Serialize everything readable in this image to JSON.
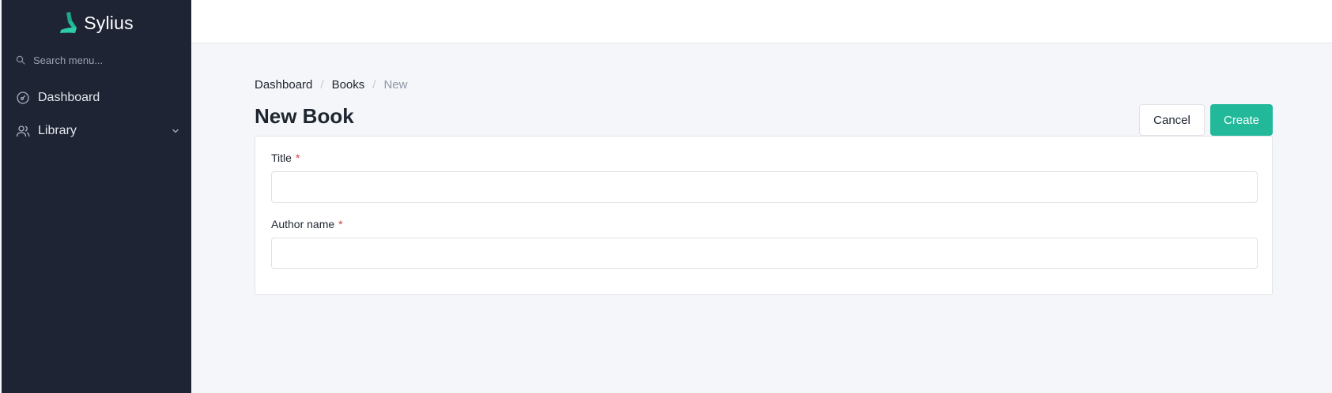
{
  "sidebar": {
    "brand": {
      "name": "Sylius",
      "logo_icon": "sylius-logo-icon",
      "logo_color": "#22b99a"
    },
    "search": {
      "placeholder": "Search menu...",
      "value": "",
      "icon": "search-icon"
    },
    "items": [
      {
        "label": "Dashboard",
        "icon": "dashboard-gauge-icon",
        "expandable": false
      },
      {
        "label": "Library",
        "icon": "users-icon",
        "expandable": true,
        "chevron_icon": "chevron-down-icon"
      }
    ],
    "background_color": "#1e2433"
  },
  "breadcrumb": {
    "items": [
      "Dashboard",
      "Books"
    ],
    "current": "New",
    "separator": "/"
  },
  "page": {
    "title": "New Book"
  },
  "actions": {
    "cancel_label": "Cancel",
    "create_label": "Create",
    "create_color": "#22b99a"
  },
  "form": {
    "fields": [
      {
        "label": "Title",
        "required_mark": "*",
        "value": ""
      },
      {
        "label": "Author name",
        "required_mark": "*",
        "value": ""
      }
    ]
  }
}
